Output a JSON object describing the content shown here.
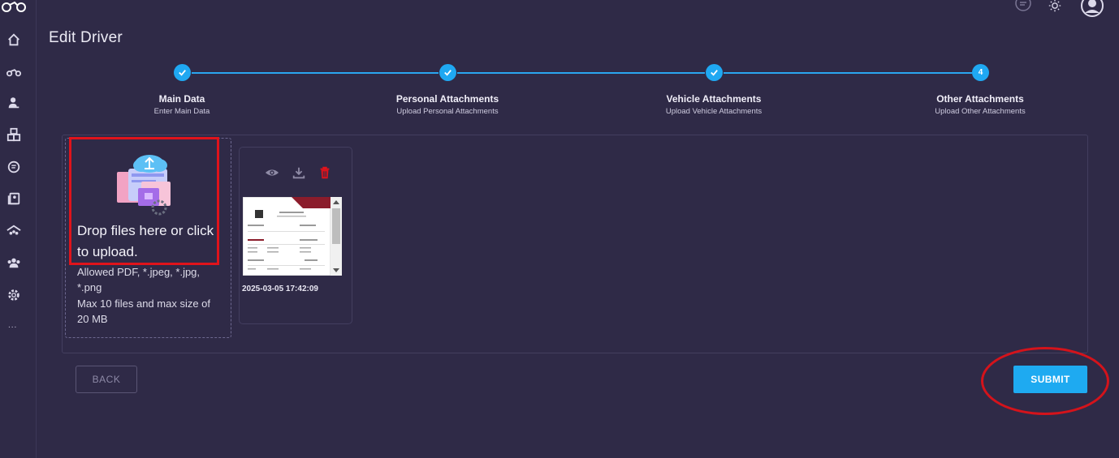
{
  "page": {
    "title": "Edit Driver"
  },
  "sidebar": {
    "icons": [
      "logo-icon",
      "home-icon",
      "motorcycle-icon",
      "driver-icon",
      "boxes-icon",
      "chat-icon",
      "book-icon",
      "warehouse-icon",
      "team-icon",
      "settings-icon"
    ],
    "more_label": "..."
  },
  "topbar": {
    "icons": [
      "notification-icon",
      "theme-toggle-icon",
      "user-avatar-icon"
    ]
  },
  "stepper": {
    "steps": [
      {
        "title": "Main Data",
        "subtitle": "Enter Main Data",
        "state": "completed"
      },
      {
        "title": "Personal Attachments",
        "subtitle": "Upload Personal Attachments",
        "state": "completed"
      },
      {
        "title": "Vehicle Attachments",
        "subtitle": "Upload Vehicle Attachments",
        "state": "completed"
      },
      {
        "title": "Other Attachments",
        "subtitle": "Upload Other Attachments",
        "state": "active",
        "number": "4"
      }
    ]
  },
  "upload": {
    "prompt": "Drop files here or click to upload.",
    "allowed": "Allowed PDF, *.jpeg, *.jpg, *.png",
    "limits": "Max 10 files and max size of 20 MB"
  },
  "files": [
    {
      "timestamp": "2025-03-05 17:42:09",
      "actions": [
        "view-icon",
        "download-icon",
        "delete-icon"
      ]
    }
  ],
  "actions": {
    "back_label": "BACK",
    "submit_label": "SUBMIT"
  },
  "colors": {
    "background": "#2f2a47",
    "accent": "#1eaaf1",
    "delete": "#e0131b",
    "annotation": "#d4131b"
  }
}
